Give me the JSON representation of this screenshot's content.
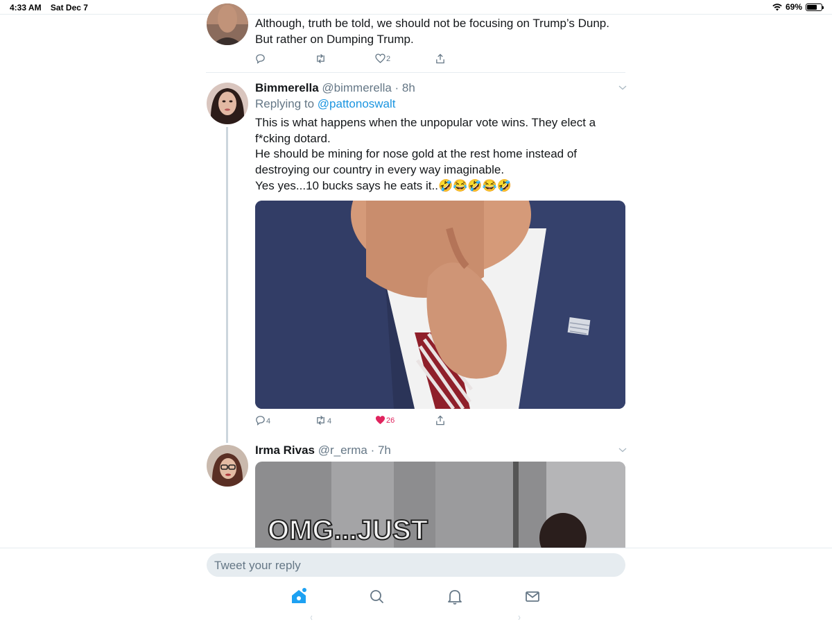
{
  "status_bar": {
    "time": "4:33 AM",
    "date": "Sat Dec 7",
    "battery_percent": "69%",
    "battery_level": 0.69,
    "wifi_icon": "wifi-icon"
  },
  "tweets": [
    {
      "text_lines": [
        "Although, truth be told, we should not be focusing on Trump’s Dunp.",
        "But rather on Dumping Trump."
      ],
      "actions": {
        "replies": "",
        "retweets": "",
        "likes": "2"
      }
    },
    {
      "name": "Bimmerella",
      "handle": "@bimmerella",
      "time": "8h",
      "replying_prefix": "Replying to",
      "replying_to": "@pattonoswalt",
      "text_lines": [
        "This is what happens when the unpopular vote wins.  They elect a",
        "f*cking dotard.",
        "He should be mining for nose gold at the rest home instead of",
        "destroying our country in every way imaginable.",
        "Yes yes...10 bucks says he eats it..🤣😂🤣😂🤣"
      ],
      "actions": {
        "replies": "4",
        "retweets": "4",
        "likes": "26",
        "liked": true
      }
    },
    {
      "name": "Irma Rivas",
      "handle": "@r_erma",
      "time": "7h",
      "media_caption": "OMG...JUST"
    }
  ],
  "reply_box": {
    "placeholder": "Tweet your reply"
  },
  "tab_bar": {
    "items": [
      "home-icon",
      "search-icon",
      "notifications-icon",
      "messages-icon"
    ]
  },
  "colors": {
    "accent": "#1da1f2",
    "like": "#e0245e",
    "muted": "#657786",
    "divider": "#e6ecf0"
  }
}
